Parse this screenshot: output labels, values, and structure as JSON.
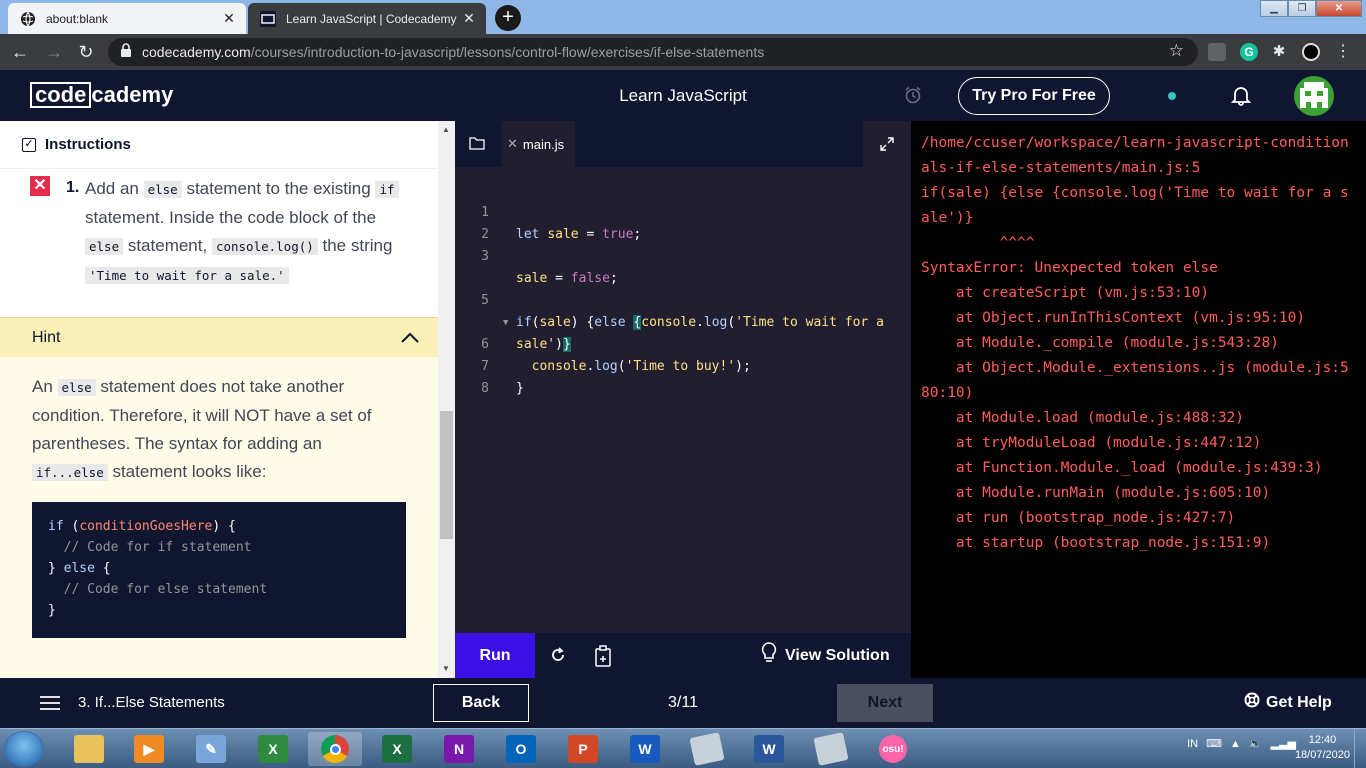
{
  "browser": {
    "tabs": [
      {
        "title": "about:blank",
        "active": false
      },
      {
        "title": "Learn JavaScript | Codecademy",
        "active": true
      }
    ],
    "new_tab": "+",
    "url_domain": "codecademy.com",
    "url_path": "/courses/introduction-to-javascript/lessons/control-flow/exercises/if-else-statements"
  },
  "header": {
    "logo_left": "code",
    "logo_right": "cademy",
    "course_title": "Learn JavaScript",
    "try_pro_label": "Try Pro For Free"
  },
  "instructions": {
    "title": "Instructions",
    "task_number": "1.",
    "task_parts": [
      "Add an ",
      "else",
      " statement to the existing ",
      "if",
      " statement. Inside the code block of the ",
      "else",
      " statement, ",
      "console.log()",
      " the string ",
      "'Time to wait for a sale.'"
    ],
    "hint_label": "Hint",
    "hint_parts": [
      "An ",
      "else",
      " statement does not take another condition. Therefore, it will NOT have a set of parentheses. The syntax for adding an ",
      "if...else",
      " statement looks like:"
    ],
    "hint_code": [
      "if (conditionGoesHere) {",
      "  // Code for if statement",
      "} else {",
      "  // Code for else statement",
      "}"
    ]
  },
  "editor": {
    "file_name": "main.js",
    "line_numbers": [
      "1",
      "2",
      "3",
      "5",
      "",
      "6",
      "7",
      "8"
    ],
    "run_label": "Run",
    "view_solution_label": "View Solution"
  },
  "output": {
    "text": "/home/ccuser/workspace/learn-javascript-conditionals-if-else-statements/main.js:5\nif(sale) {else {console.log('Time to wait for a sale')}\n         ^^^^\nSyntaxError: Unexpected token else\n    at createScript (vm.js:53:10)\n    at Object.runInThisContext (vm.js:95:10)\n    at Module._compile (module.js:543:28)\n    at Object.Module._extensions..js (module.js:580:10)\n    at Module.load (module.js:488:32)\n    at tryModuleLoad (module.js:447:12)\n    at Function.Module._load (module.js:439:3)\n    at Module.runMain (module.js:605:10)\n    at run (bootstrap_node.js:427:7)\n    at startup (bootstrap_node.js:151:9)"
  },
  "footer": {
    "lesson_name": "3. If...Else Statements",
    "back_label": "Back",
    "progress": "3/11",
    "next_label": "Next",
    "help_label": "Get Help"
  },
  "taskbar": {
    "language": "IN",
    "time": "12:40",
    "date": "18/07/2020",
    "osu_label": "osu!"
  },
  "colors": {
    "cc_navy": "#10162f",
    "run_blue": "#3a10e5",
    "error_red": "#ff5c5c",
    "hint_yellow": "#fbf0b7"
  }
}
